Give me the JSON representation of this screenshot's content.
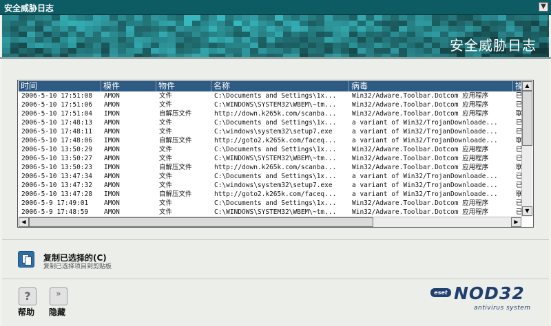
{
  "window": {
    "title": "安全威胁日志"
  },
  "banner": {
    "heading": "安全威胁日志"
  },
  "log_table": {
    "columns": [
      "时间",
      "模件",
      "物件",
      "名称",
      "病毒",
      "操"
    ],
    "rows": [
      [
        "2006-5-10 17:51:08",
        "AMON",
        "文件",
        "C:\\Documents and Settings\\1x...",
        "Win32/Adware.Toolbar.Dotcom 应用程序",
        "已"
      ],
      [
        "2006-5-10 17:51:06",
        "AMON",
        "文件",
        "C:\\WINDOWS\\SYSTEM32\\WBEM\\~tm...",
        "Win32/Adware.Toolbar.Dotcom 应用程序",
        "已"
      ],
      [
        "2006-5-10 17:51:04",
        "IMON",
        "自解压文件",
        "http://down.k265k.com/scanba...",
        "Win32/Adware.Toolbar.Dotcom 应用程序",
        "联"
      ],
      [
        "2006-5-10 17:48:13",
        "AMON",
        "文件",
        "C:\\Documents and Settings\\1x...",
        "a variant of Win32/TrojanDownloade...",
        "已"
      ],
      [
        "2006-5-10 17:48:11",
        "AMON",
        "文件",
        "C:\\windows\\system32\\setup7.exe",
        "a variant of Win32/TrojanDownloade...",
        "已"
      ],
      [
        "2006-5-10 17:48:06",
        "IMON",
        "自解压文件",
        "http://goto2.k265k.com/faceq...",
        "a variant of Win32/TrojanDownloade...",
        "联"
      ],
      [
        "2006-5-10 13:50:29",
        "AMON",
        "文件",
        "C:\\Documents and Settings\\1x...",
        "Win32/Adware.Toolbar.Dotcom 应用程序",
        "已"
      ],
      [
        "2006-5-10 13:50:27",
        "AMON",
        "文件",
        "C:\\WINDOWS\\SYSTEM32\\WBEM\\~tm...",
        "Win32/Adware.Toolbar.Dotcom 应用程序",
        "已"
      ],
      [
        "2006-5-10 13:50:23",
        "IMON",
        "自解压文件",
        "http://down.k265k.com/scanba...",
        "Win32/Adware.Toolbar.Dotcom 应用程序",
        "联"
      ],
      [
        "2006-5-10 13:47:34",
        "AMON",
        "文件",
        "C:\\Documents and Settings\\1x...",
        "a variant of Win32/TrojanDownloade...",
        "已"
      ],
      [
        "2006-5-10 13:47:32",
        "AMON",
        "文件",
        "C:\\windows\\system32\\setup7.exe",
        "a variant of Win32/TrojanDownloade...",
        "已"
      ],
      [
        "2006-5-10 13:47:28",
        "IMON",
        "自解压文件",
        "http://goto2.k265k.com/faceq...",
        "a variant of Win32/TrojanDownloade...",
        "联"
      ],
      [
        "2006-5-9 17:49:01",
        "AMON",
        "文件",
        "C:\\Documents and Settings\\1x...",
        "Win32/Adware.Toolbar.Dotcom 应用程序",
        "已"
      ],
      [
        "2006-5-9 17:48:59",
        "AMON",
        "文件",
        "C:\\WINDOWS\\SYSTEM32\\WBEM\\~tm...",
        "Win32/Adware.Toolbar.Dotcom 应用程序",
        "已"
      ]
    ]
  },
  "copy_action": {
    "title": "复制已选择的(C)",
    "description": "复制已选择项目到剪贴板"
  },
  "buttons": {
    "help": "帮助",
    "hide": "隐藏",
    "help_glyph": "?",
    "hide_glyph": "»"
  },
  "branding": {
    "eset": "eset",
    "product": "NOD32",
    "tagline": "antivirus system"
  },
  "colors": {
    "title_bar": "#0d5c64",
    "banner": "#0b6a6e",
    "table_header": "#2e5b84",
    "brand": "#1f3f6e"
  }
}
